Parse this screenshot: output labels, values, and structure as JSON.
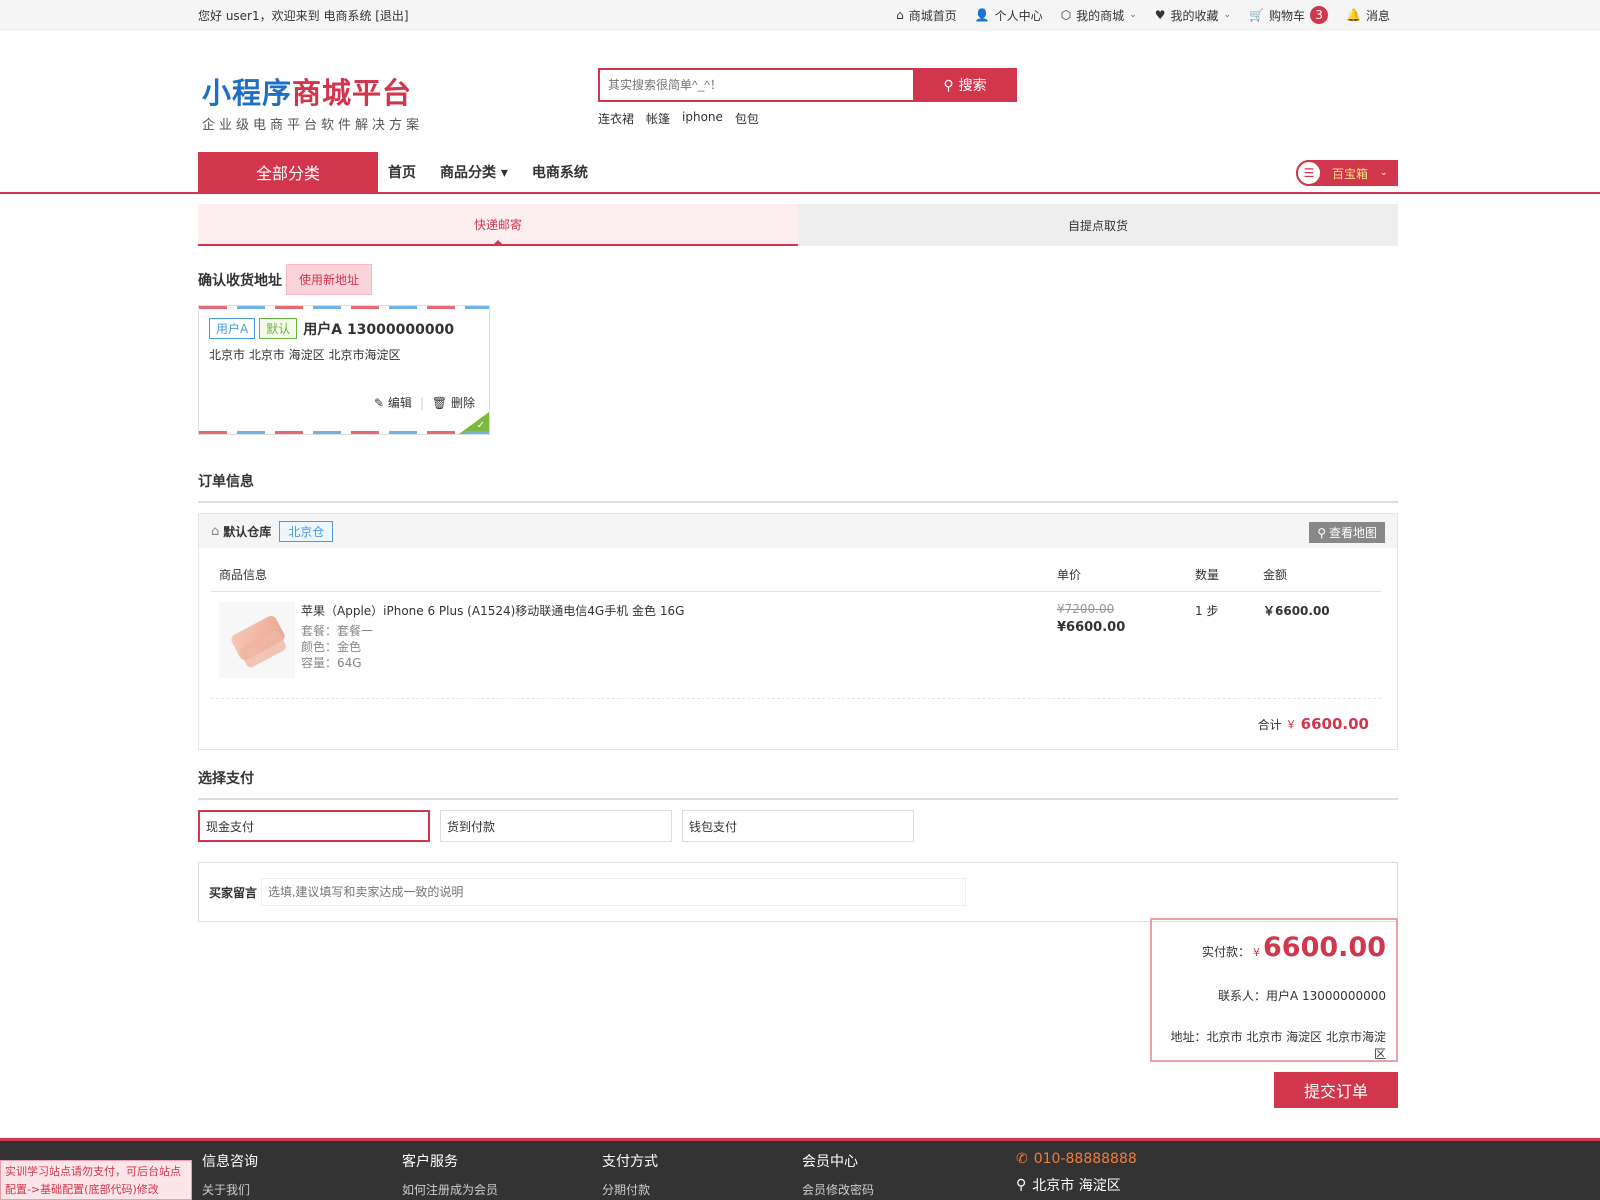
{
  "topbar": {
    "greeting": "您好 user1，欢迎来到 电商系统 [退出]",
    "links": [
      {
        "icon": "home-icon",
        "label": "商城首页"
      },
      {
        "icon": "user-icon",
        "label": "个人中心"
      },
      {
        "icon": "cube-icon",
        "label": "我的商城"
      },
      {
        "icon": "heart-icon",
        "label": "我的收藏"
      },
      {
        "icon": "cart-icon",
        "label": "购物车",
        "badge": "3"
      },
      {
        "icon": "bell-icon",
        "label": "消息"
      }
    ]
  },
  "header": {
    "logo_part1": "小程序",
    "logo_part2": "商城平台",
    "logo_sub": "企业级电商平台软件解决方案",
    "search_placeholder": "其实搜索很简单^_^！",
    "search_button": "搜索",
    "hot_keywords": [
      "连衣裙",
      "帐篷",
      "iphone",
      "包包"
    ]
  },
  "nav": {
    "all_categories": "全部分类",
    "links": [
      "首页",
      "商品分类",
      "电商系统"
    ],
    "treasure": "百宝箱"
  },
  "delivery_tabs": [
    "快递邮寄",
    "自提点取货"
  ],
  "address": {
    "section_title": "确认收货地址",
    "new_button": "使用新地址",
    "tag_alias": "用户A",
    "tag_default": "默认",
    "name_phone": "用户A 13000000000",
    "detail": "北京市 北京市 海淀区 北京市海淀区",
    "edit": "编辑",
    "delete": "删除"
  },
  "order": {
    "title": "订单信息",
    "warehouse_label": "默认仓库",
    "warehouse_tag": "北京仓",
    "map_button": "查看地图",
    "columns": [
      "商品信息",
      "单价",
      "数量",
      "金额"
    ],
    "item": {
      "name": "苹果（Apple）iPhone 6 Plus (A1524)移动联通电信4G手机 金色 16G",
      "attrs": [
        "套餐：套餐一",
        "颜色：金色",
        "容量：64G"
      ],
      "price_old": "¥7200.00",
      "price_new": "¥6600.00",
      "qty": "1 步",
      "amount": "￥6600.00"
    },
    "total_label": "合计",
    "total_currency": "￥",
    "total_value": "6600.00"
  },
  "payment": {
    "title": "选择支付",
    "options": [
      "现金支付",
      "货到付款",
      "钱包支付"
    ]
  },
  "message": {
    "label": "买家留言",
    "placeholder": "选填,建议填写和卖家达成一致的说明"
  },
  "summary": {
    "pay_label": "实付款：",
    "currency": "¥",
    "pay_value": "6600.00",
    "contact": "联系人：用户A 13000000000",
    "address": "地址：北京市 北京市 海淀区 北京市海淀区",
    "submit": "提交订单"
  },
  "footer": {
    "columns": [
      {
        "title": "信息咨询",
        "first": "关于我们"
      },
      {
        "title": "客户服务",
        "first": "如何注册成为会员"
      },
      {
        "title": "支付方式",
        "first": "分期付款"
      },
      {
        "title": "会员中心",
        "first": "会员修改密码"
      }
    ],
    "phone": "010-88888888",
    "location": "北京市 海淀区",
    "notice": "实训学习站点请勿支付，可后台站点配置->基础配置(底部代码)修改"
  },
  "colors": {
    "accent": "#d2364c",
    "brand_blue": "#1f6fc2",
    "success": "#7fb83e"
  }
}
